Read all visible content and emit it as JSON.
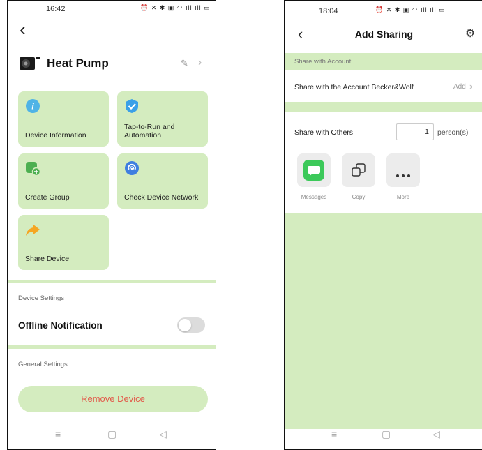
{
  "left": {
    "status": {
      "time": "16:42",
      "icons": "⏰ ✕ ✱ ▣ ◠ ıll ıll ▭"
    },
    "back_icon": "‹",
    "device_name": "Heat Pump",
    "edit_icon": "✎",
    "chevron": "›",
    "tiles": [
      {
        "label": "Device Information",
        "icon": "info-icon",
        "color": "#4fb3e6"
      },
      {
        "label": "Tap-to-Run and Automation",
        "icon": "check-shield-icon",
        "color": "#3aa0e8"
      },
      {
        "label": "Create Group",
        "icon": "create-group-icon",
        "color": "#4caf50"
      },
      {
        "label": "Check Device Network",
        "icon": "network-icon",
        "color": "#3f7fe0"
      },
      {
        "label": "Share Device",
        "icon": "share-arrow-icon",
        "color": "#f5a623"
      }
    ],
    "device_settings_header": "Device Settings",
    "offline_notification_label": "Offline Notification",
    "offline_notification_on": false,
    "general_settings_header": "General Settings",
    "remove_device_label": "Remove Device",
    "nav": {
      "menu": "≡",
      "home": "▢",
      "back": "◁"
    }
  },
  "right": {
    "status": {
      "time": "18:04",
      "icons": "⏰ ✕ ✱ ▣ ◠ ıll ıll ▭"
    },
    "back_icon": "‹",
    "title": "Add Sharing",
    "settings_icon": "⚙",
    "share_with_account_header": "Share with Account",
    "share_account_row": "Share with the Account Becker&Wolf",
    "add_label": "Add",
    "add_chevron": "›",
    "share_with_others_label": "Share with Others",
    "persons_value": "1",
    "persons_unit": "person(s)",
    "share_options": [
      {
        "label": "Messages",
        "icon": "messages-icon"
      },
      {
        "label": "Copy",
        "icon": "copy-icon"
      },
      {
        "label": "More",
        "icon": "more-icon"
      }
    ],
    "nav": {
      "menu": "≡",
      "home": "▢",
      "back": "◁"
    }
  },
  "colors": {
    "accent_green": "#d4ecbf",
    "remove_red": "#e25b4b",
    "toggle_off": "#dcdcdc"
  }
}
